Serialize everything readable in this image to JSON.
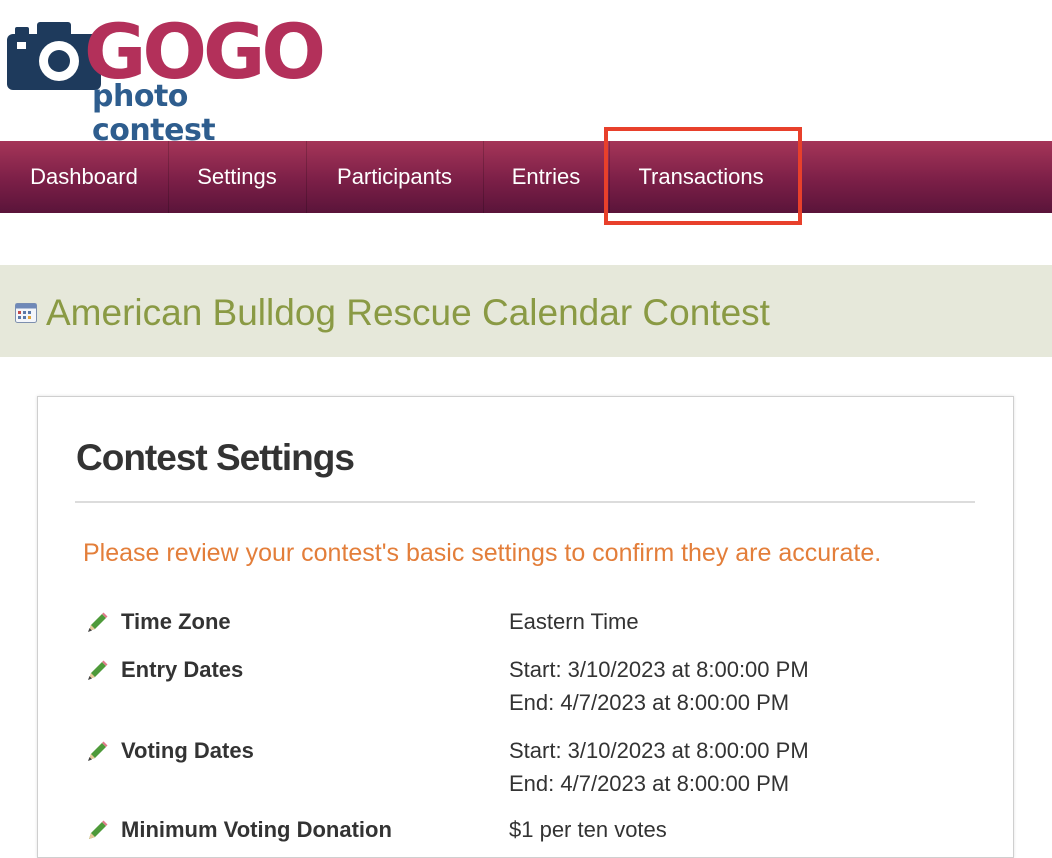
{
  "logo": {
    "brand": "GOGO",
    "subtitle": "photo contest"
  },
  "nav": {
    "items": [
      {
        "label": "Dashboard"
      },
      {
        "label": "Settings"
      },
      {
        "label": "Participants"
      },
      {
        "label": "Entries"
      },
      {
        "label": "Transactions"
      }
    ],
    "highlighted": "Transactions"
  },
  "contest": {
    "title": "American Bulldog Rescue Calendar Contest"
  },
  "settings": {
    "heading": "Contest Settings",
    "notice": "Please review your contest's basic settings to confirm they are accurate.",
    "rows": [
      {
        "label": "Time Zone",
        "lines": [
          "Eastern Time"
        ]
      },
      {
        "label": "Entry Dates",
        "lines": [
          "Start: 3/10/2023 at 8:00:00 PM",
          "End: 4/7/2023 at 8:00:00 PM"
        ]
      },
      {
        "label": "Voting Dates",
        "lines": [
          "Start: 3/10/2023 at 8:00:00 PM",
          "End: 4/7/2023 at 8:00:00 PM"
        ]
      },
      {
        "label": "Minimum Voting Donation",
        "lines": [
          "$1 per ten votes"
        ]
      }
    ]
  },
  "colors": {
    "nav_top": "#a53558",
    "nav_bottom": "#5a143a",
    "highlight": "#e8402b",
    "title_green": "#8a9a44",
    "notice_orange": "#e37e3a",
    "logo_pink": "#b3305a",
    "logo_blue": "#2e5d8e"
  }
}
